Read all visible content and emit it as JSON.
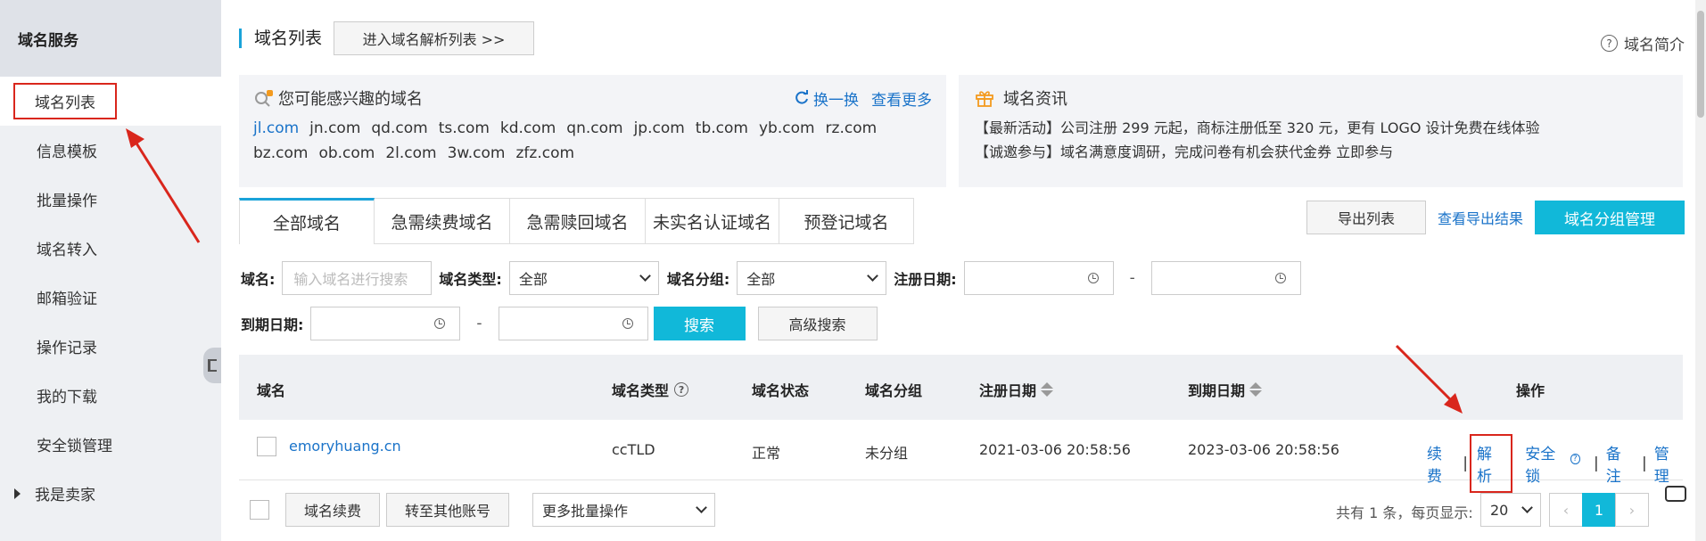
{
  "sidebar": {
    "header": "域名服务",
    "items": [
      {
        "label": "域名列表",
        "active": true
      },
      {
        "label": "信息模板"
      },
      {
        "label": "批量操作"
      },
      {
        "label": "域名转入"
      },
      {
        "label": "邮箱验证"
      },
      {
        "label": "操作记录"
      },
      {
        "label": "我的下载"
      },
      {
        "label": "安全锁管理"
      }
    ],
    "group_label": "我是卖家"
  },
  "header": {
    "title": "域名列表",
    "goto_dns_label": "进入域名解析列表 >>",
    "help_label": "域名简介"
  },
  "suggest": {
    "title": "您可能感兴趣的域名",
    "refresh_label": "换一换",
    "more_label": "查看更多",
    "domains": [
      "jl.com",
      "jn.com",
      "qd.com",
      "ts.com",
      "kd.com",
      "qn.com",
      "jp.com",
      "tb.com",
      "yb.com",
      "rz.com",
      "bz.com",
      "ob.com",
      "2l.com",
      "3w.com",
      "zfz.com"
    ]
  },
  "news": {
    "title": "域名资讯",
    "lines": [
      "【最新活动】公司注册 299 元起，商标注册低至 320 元，更有 LOGO 设计免费在线体验",
      "【诚邀参与】域名满意度调研，完成问卷有机会获代金券 立即参与"
    ]
  },
  "tabs": [
    "全部域名",
    "急需续费域名",
    "急需赎回域名",
    "未实名认证域名",
    "预登记域名"
  ],
  "toolbar": {
    "export_label": "导出列表",
    "export_result_label": "查看导出结果",
    "group_manage_label": "域名分组管理"
  },
  "filters": {
    "domain_label": "域名:",
    "domain_placeholder": "输入域名进行搜索",
    "type_label": "域名类型:",
    "type_value": "全部",
    "group_label": "域名分组:",
    "group_value": "全部",
    "reg_date_label": "注册日期:",
    "expire_date_label": "到期日期:",
    "dash": "-",
    "search_label": "搜索",
    "advanced_label": "高级搜索"
  },
  "table": {
    "columns": [
      "域名",
      "域名类型",
      "域名状态",
      "域名分组",
      "注册日期",
      "到期日期",
      "操作"
    ],
    "rows": [
      {
        "domain": "emoryhuang.cn",
        "type": "ccTLD",
        "status": "正常",
        "group": "未分组",
        "reg_date": "2021-03-06 20:58:56",
        "expire_date": "2023-03-06 20:58:56",
        "ops": [
          "续费",
          "解析",
          "安全锁",
          "备注",
          "管理"
        ]
      }
    ]
  },
  "footer": {
    "renew_label": "域名续费",
    "transfer_label": "转至其他账号",
    "batch_label": "更多批量操作",
    "total_text": "共有 1 条，每页显示:",
    "page_size": "20",
    "prev": "‹",
    "current_page": "1",
    "next": "›"
  },
  "colors": {
    "accent": "#11b8d9",
    "link": "#1a73c9",
    "annotation": "#d9261c"
  }
}
